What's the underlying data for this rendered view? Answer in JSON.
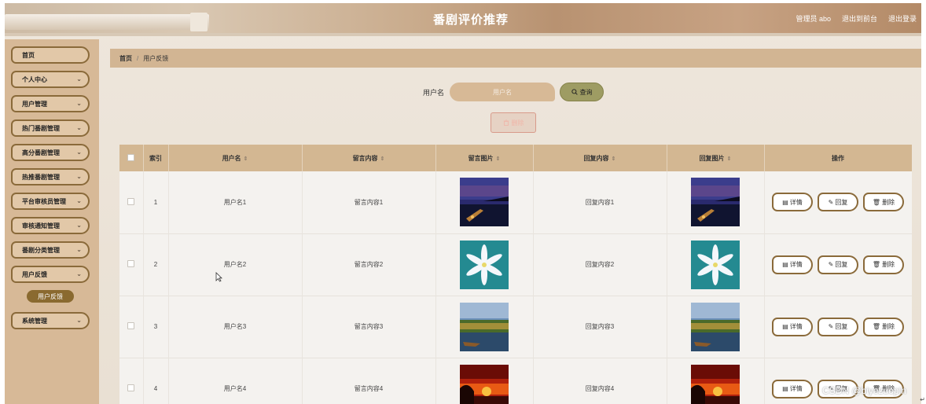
{
  "header": {
    "title": "番剧评价推荐",
    "admin_text": "管理员 abo",
    "to_front": "退出到前台",
    "logout": "退出登录"
  },
  "sidebar": {
    "items": [
      {
        "label": "首页",
        "chevron": false
      },
      {
        "label": "个人中心",
        "chevron": true
      },
      {
        "label": "用户管理",
        "chevron": true
      },
      {
        "label": "热门番剧管理",
        "chevron": true
      },
      {
        "label": "高分番剧管理",
        "chevron": true
      },
      {
        "label": "热推番剧管理",
        "chevron": true
      },
      {
        "label": "平台审核员管理",
        "chevron": true
      },
      {
        "label": "审核通知管理",
        "chevron": true
      },
      {
        "label": "番剧分类管理",
        "chevron": true
      },
      {
        "label": "用户反馈",
        "chevron": true
      },
      {
        "label": "系统管理",
        "chevron": true
      }
    ],
    "active_sub": "用户反馈",
    "chevron_glyph": "⌄"
  },
  "breadcrumb": {
    "home": "首页",
    "sep": "/",
    "current": "用户反馈"
  },
  "search": {
    "label": "用户名",
    "placeholder": "用户名",
    "button": "查询",
    "delete_button": "删除"
  },
  "table": {
    "headers": {
      "index": "索引",
      "username": "用户名",
      "message": "留言内容",
      "message_image": "留言图片",
      "reply": "回复内容",
      "reply_image": "回复图片",
      "actions": "操作"
    },
    "sort_glyph": "⇕",
    "rows": [
      {
        "index": "1",
        "username": "用户名1",
        "message": "留言内容1",
        "reply": "回复内容1",
        "image": "night-pier"
      },
      {
        "index": "2",
        "username": "用户名2",
        "message": "留言内容2",
        "reply": "回复内容2",
        "image": "white-flower"
      },
      {
        "index": "3",
        "username": "用户名3",
        "message": "留言内容3",
        "reply": "回复内容3",
        "image": "palm-lake"
      },
      {
        "index": "4",
        "username": "用户名4",
        "message": "留言内容4",
        "reply": "回复内容4",
        "image": "red-sunset"
      }
    ],
    "action_labels": {
      "detail": "详情",
      "reply": "回复",
      "delete": "删除"
    }
  },
  "watermark": "CSDN @biyezuopin",
  "colors": {
    "accent": "#8a6a3a",
    "sidebar_bg": "#d7b997",
    "header_bg": "#c9ab8c",
    "search_btn": "#9e9c63"
  }
}
